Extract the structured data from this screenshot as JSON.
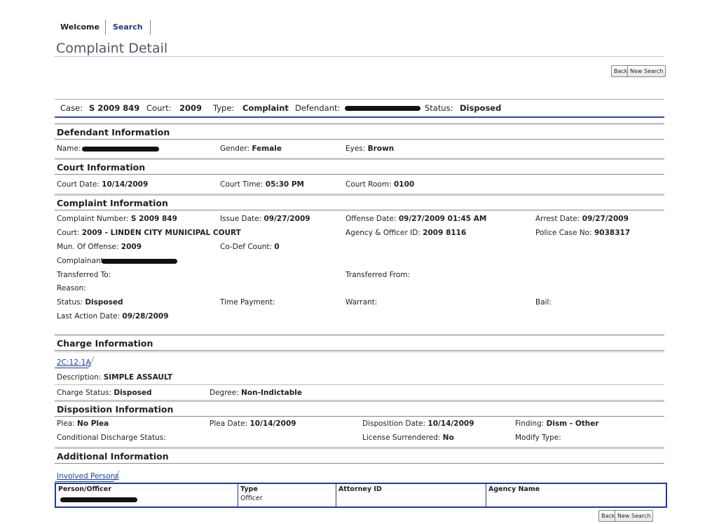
{
  "nav": {
    "tabs": [
      "Welcome",
      "Search"
    ]
  },
  "page": {
    "title": "Complaint Detail"
  },
  "buttons": {
    "back": "Back",
    "new_search": "New Search"
  },
  "summary": {
    "case_label": "Case:",
    "case_value": "S 2009 849",
    "court_label": "Court:",
    "court_value": "2009",
    "type_label": "Type:",
    "type_value": "Complaint",
    "defendant_label": "Defendant:",
    "status_label": "Status:",
    "status_value": "Disposed"
  },
  "defendant": {
    "heading": "Defendant Information",
    "name_label": "Name:",
    "gender_label": "Gender:",
    "gender_value": "Female",
    "eyes_label": "Eyes:",
    "eyes_value": "Brown"
  },
  "court": {
    "heading": "Court Information",
    "date_label": "Court Date:",
    "date_value": "10/14/2009",
    "time_label": "Court Time:",
    "time_value": "05:30 PM",
    "room_label": "Court Room:",
    "room_value": "0100"
  },
  "complaint": {
    "heading": "Complaint Information",
    "number_label": "Complaint Number:",
    "number_value": "S 2009 849",
    "issue_label": "Issue Date:",
    "issue_value": "09/27/2009",
    "offense_label": "Offense Date:",
    "offense_value": "09/27/2009 01:45 AM",
    "arrest_label": "Arrest Date:",
    "arrest_value": "09/27/2009",
    "court_label": "Court:",
    "court_value": "2009 - LINDEN CITY MUNICIPAL COURT",
    "agency_label": "Agency & Officer ID:",
    "agency_value": "2009 8116",
    "police_label": "Police Case No:",
    "police_value": "9038317",
    "mun_label": "Mun. Of Offense:",
    "mun_value": "2009",
    "codef_label": "Co-Def Count:",
    "codef_value": "0",
    "complainant_label": "Complainant:",
    "transferred_to_label": "Transferred To:",
    "transferred_from_label": "Transferred From:",
    "reason_label": "Reason:",
    "status_label": "Status:",
    "status_value": "Disposed",
    "time_payment_label": "Time Payment:",
    "warrant_label": "Warrant:",
    "bail_label": "Bail:",
    "last_action_label": "Last Action Date:",
    "last_action_value": "09/28/2009"
  },
  "charge": {
    "heading": "Charge Information",
    "statute": "2C:12-1A",
    "description_label": "Description:",
    "description_value": "SIMPLE ASSAULT",
    "status_label": "Charge Status:",
    "status_value": "Disposed",
    "degree_label": "Degree:",
    "degree_value": "Non-Indictable"
  },
  "disposition": {
    "heading": "Disposition Information",
    "plea_label": "Plea:",
    "plea_value": "No Plea",
    "plea_date_label": "Plea Date:",
    "plea_date_value": "10/14/2009",
    "disp_date_label": "Disposition Date:",
    "disp_date_value": "10/14/2009",
    "finding_label": "Finding:",
    "finding_value": "Dism - Other",
    "cond_label": "Conditional Discharge Status:",
    "license_label": "License Surrendered:",
    "license_value": "No",
    "modify_label": "Modify Type:"
  },
  "additional": {
    "heading": "Additional Information",
    "tab": "Involved Persons",
    "columns": [
      "Person/Officer",
      "Type",
      "Attorney ID",
      "Agency Name"
    ],
    "row_type": "Officer"
  }
}
